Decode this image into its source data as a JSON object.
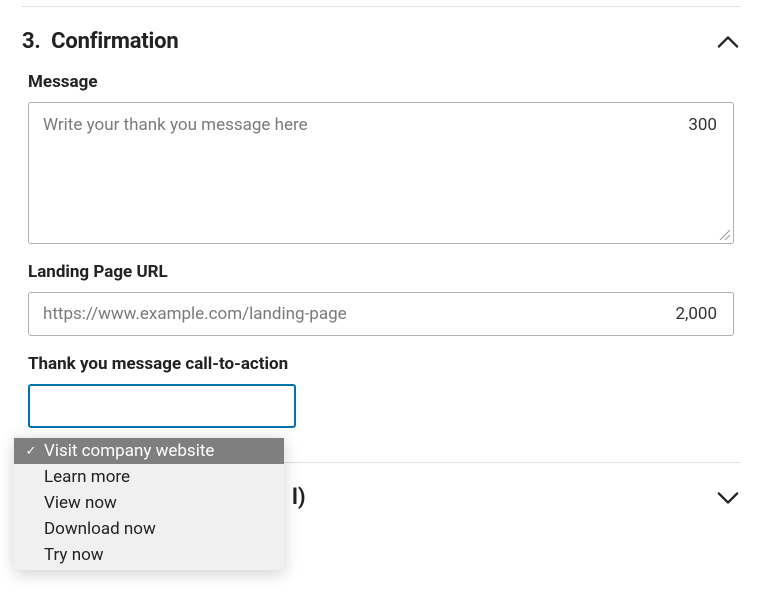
{
  "section": {
    "number": "3.",
    "title": "Confirmation"
  },
  "message": {
    "label": "Message",
    "placeholder": "Write your thank you message here",
    "value": "",
    "counter": "300"
  },
  "landing": {
    "label": "Landing Page URL",
    "placeholder": "https://www.example.com/landing-page",
    "value": "",
    "counter": "2,000"
  },
  "cta": {
    "label": "Thank you message call-to-action",
    "options": [
      "Visit company website",
      "Learn more",
      "View now",
      "Download now",
      "Try now"
    ],
    "selected_index": 0
  },
  "lower": {
    "title_fragment": "l)"
  }
}
